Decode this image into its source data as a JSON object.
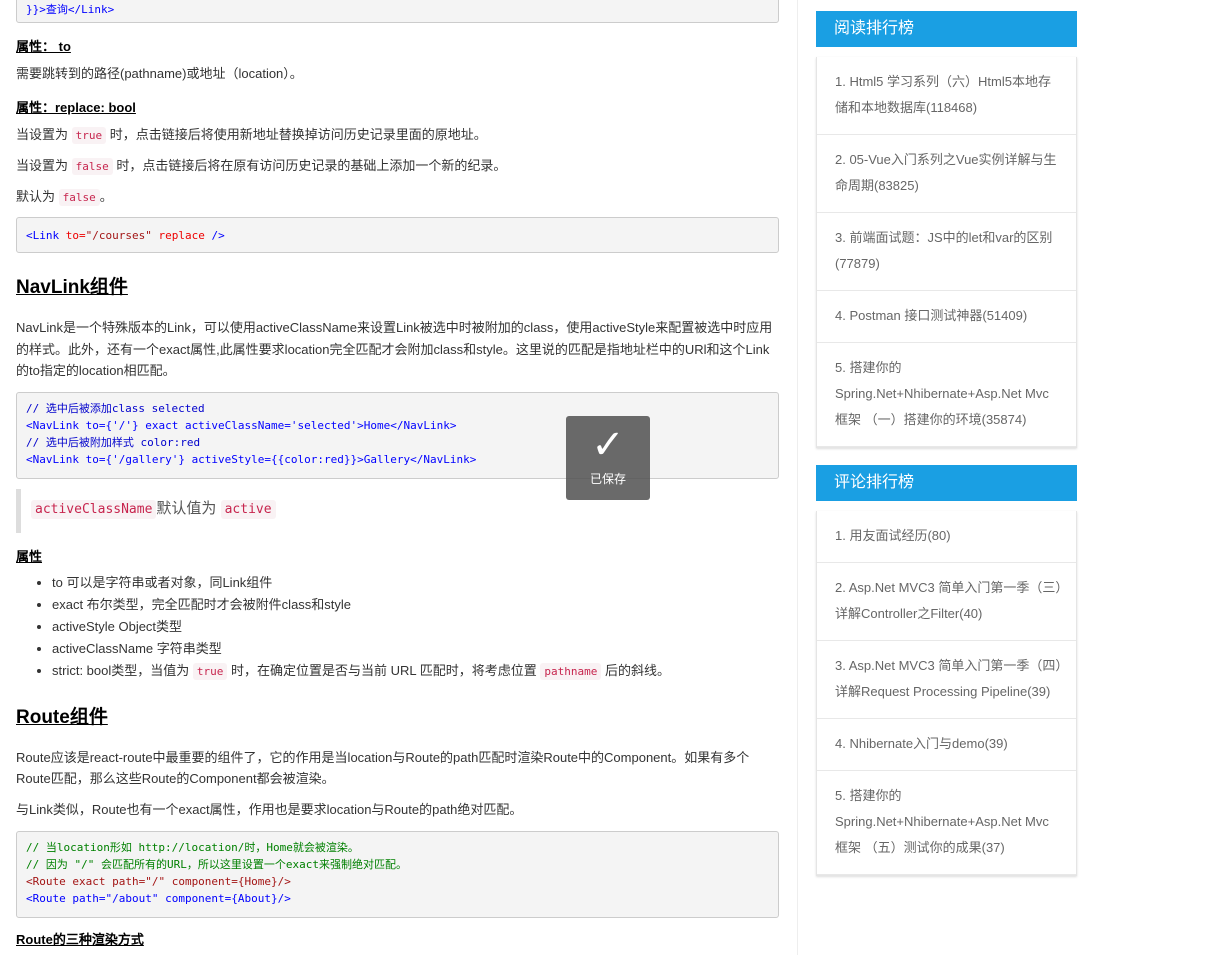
{
  "main": {
    "code0_tail": "}}>查询</Link>",
    "to_heading": "属性： to",
    "to_desc": "需要跳转到的路径(pathname)或地址（location）。",
    "replace_heading": "属性：replace: bool",
    "replace_p1_a": "当设置为",
    "replace_p1_code": "true",
    "replace_p1_b": "时，点击链接后将使用新地址替换掉访问历史记录里面的原地址。",
    "replace_p2_a": "当设置为",
    "replace_p2_code": "false",
    "replace_p2_b": "时，点击链接后将在原有访问历史记录的基础上添加一个新的纪录。",
    "replace_p3_a": "默认为",
    "replace_p3_code": "false",
    "replace_p3_b": "。",
    "code1": {
      "t1": "<Link ",
      "a1": "to=",
      "s1": "\"/courses\" ",
      "a2": "replace ",
      "t2": "/>"
    },
    "navlink_title": "NavLink组件",
    "navlink_desc": "NavLink是一个特殊版本的Link，可以使用activeClassName来设置Link被选中时被附加的class，使用activeStyle来配置被选中时应用的样式。此外，还有一个exact属性,此属性要求location完全匹配才会附加class和style。这里说的匹配是指地址栏中的URl和这个Link的to指定的location相匹配。",
    "code2": [
      "// 选中后被添加class selected",
      "<NavLink to={'/'} exact activeClassName='selected'>Home</NavLink>",
      "// 选中后被附加样式 color:red",
      "<NavLink to={'/gallery'} activeStyle={{color:red}}>Gallery</NavLink>"
    ],
    "quote_code1": "activeClassName",
    "quote_text": "默认值为",
    "quote_code2": "active",
    "props_heading": "属性",
    "props": [
      "to 可以是字符串或者对象，同Link组件",
      "exact 布尔类型，完全匹配时才会被附件class和style",
      "activeStyle Object类型",
      "activeClassName 字符串类型"
    ],
    "strict_a": "strict: bool类型，当值为",
    "strict_code1": "true",
    "strict_b": "时，在确定位置是否与当前 URL 匹配时，将考虑位置",
    "strict_code2": "pathname",
    "strict_c": "后的斜线。",
    "route_title": "Route组件",
    "route_desc": "Route应该是react-route中最重要的组件了，它的作用是当location与Route的path匹配时渲染Route中的Component。如果有多个Route匹配，那么这些Route的Component都会被渲染。",
    "route_desc2": "与Link类似，Route也有一个exact属性，作用也是要求location与Route的path绝对匹配。",
    "code3": [
      "// 当location形如 http://location/时，Home就会被渲染。",
      "// 因为 \"/\" 会匹配所有的URL，所以这里设置一个exact来强制绝对匹配。",
      "<Route exact path=\"/\" component={Home}/>",
      "<Route path=\"/about\" component={About}/>"
    ],
    "render_heading": "Route的三种渲染方式"
  },
  "sidebar": {
    "read_title": "阅读排行榜",
    "read": [
      "1. Html5 学习系列（六）Html5本地存储和本地数据库(118468)",
      "2. 05-Vue入门系列之Vue实例详解与生命周期(83825)",
      "3. 前端面试题：JS中的let和var的区别(77879)",
      "4. Postman 接口测试神器(51409)",
      "5. 搭建你的Spring.Net+Nhibernate+Asp.Net Mvc 框架 （一）搭建你的环境(35874)"
    ],
    "comment_title": "评论排行榜",
    "comment": [
      "1. 用友面试经历(80)",
      "2. Asp.Net MVC3 简单入门第一季（三）详解Controller之Filter(40)",
      "3. Asp.Net MVC3 简单入门第一季（四）详解Request Processing Pipeline(39)",
      "4. Nhibernate入门与demo(39)",
      "5. 搭建你的Spring.Net+Nhibernate+Asp.Net Mvc 框架 （五）测试你的成果(37)"
    ]
  },
  "toast": {
    "text": "已保存",
    "icon": "check-icon"
  },
  "colors": {
    "accent": "#1a9fe3"
  }
}
